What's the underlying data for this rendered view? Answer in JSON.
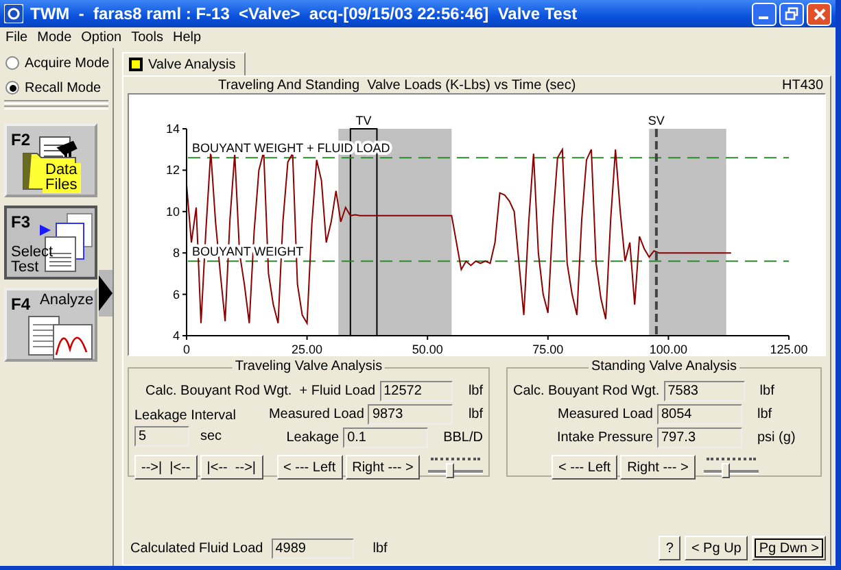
{
  "window": {
    "title": "TWM  -  faras8 raml : F-13  <Valve>  acq-[09/15/03 22:56:46]  Valve Test"
  },
  "menu": [
    "File",
    "Mode",
    "Option",
    "Tools",
    "Help"
  ],
  "modes": [
    {
      "label": "Acquire Mode",
      "selected": false
    },
    {
      "label": "Recall Mode",
      "selected": true
    }
  ],
  "function_keys": [
    {
      "key": "F2",
      "label": "Data Files",
      "kind": "folder",
      "selected": false
    },
    {
      "key": "F3",
      "label": "Select Test",
      "kind": "documents",
      "selected": true
    },
    {
      "key": "F4",
      "label": "Analyze",
      "kind": "charts",
      "selected": false
    }
  ],
  "tabs": [
    {
      "label": "Valve Analysis",
      "selected": true
    }
  ],
  "chart": {
    "code": "HT430",
    "chart_data": {
      "type": "line",
      "title": "Traveling And Standing  Valve Loads (K-Lbs) vs Time (sec)",
      "xlim": [
        0,
        125
      ],
      "ylim": [
        4,
        14
      ],
      "yticks": [
        4,
        6,
        8,
        10,
        12,
        14
      ],
      "xticks": [
        {
          "value": 0,
          "label": "0"
        },
        {
          "value": 25,
          "label": "25.00"
        },
        {
          "value": 50,
          "label": "50.00"
        },
        {
          "value": 75,
          "label": "75.00"
        },
        {
          "value": 100,
          "label": "100.00"
        },
        {
          "value": 125,
          "label": "125.00"
        }
      ],
      "x": [
        0,
        1,
        2,
        3,
        4,
        5,
        6,
        7,
        8,
        9,
        10,
        11,
        12,
        13,
        14,
        15,
        16,
        17,
        18,
        19,
        20,
        21,
        22,
        23,
        24,
        25,
        26,
        27,
        28,
        29,
        30,
        31,
        32,
        33,
        34,
        35,
        36,
        37,
        38,
        39,
        40,
        41,
        42,
        43,
        44,
        45,
        46,
        47,
        48,
        49,
        50,
        51,
        52,
        53,
        54,
        55,
        56,
        57,
        58,
        59,
        60,
        61,
        62,
        63,
        64,
        65,
        66,
        67,
        68,
        69,
        70,
        71,
        72,
        73,
        74,
        75,
        76,
        77,
        78,
        79,
        80,
        81,
        82,
        83,
        84,
        85,
        86,
        87,
        88,
        89,
        90,
        91,
        92,
        93,
        94,
        95,
        96,
        97,
        98,
        99,
        100,
        101,
        102,
        103,
        104,
        105,
        106,
        107,
        108,
        109,
        110,
        111,
        112,
        113
      ],
      "series": [
        {
          "color": "#8b0000",
          "values": [
            11.3,
            8.5,
            10.2,
            4.6,
            9,
            12.9,
            9.5,
            7,
            4.7,
            9.6,
            12.8,
            8,
            6.5,
            4.6,
            9,
            12,
            12.9,
            7,
            5.5,
            4.6,
            9.5,
            12.4,
            12.8,
            6.5,
            5,
            4.6,
            9.4,
            12.5,
            11.5,
            8.5,
            9.5,
            11,
            9.5,
            10.2,
            9.8,
            9.85,
            9.8,
            9.8,
            9.8,
            9.8,
            9.8,
            9.8,
            9.8,
            9.8,
            9.8,
            9.8,
            9.8,
            9.8,
            9.8,
            9.8,
            9.8,
            9.8,
            9.8,
            9.8,
            9.8,
            9.8,
            8.5,
            7.2,
            7.6,
            7.4,
            7.6,
            7.5,
            7.6,
            7.5,
            8.5,
            10.9,
            10.8,
            10.5,
            10,
            7.5,
            5,
            9.5,
            12.8,
            8,
            6,
            5.1,
            9.5,
            12.6,
            13,
            7.5,
            6,
            5,
            9.6,
            12.5,
            13,
            7.5,
            5.8,
            4.8,
            9.6,
            13,
            10,
            7.6,
            8.5,
            5.5,
            8.8,
            8.2,
            7.8,
            8.1,
            8,
            8,
            8,
            8,
            8,
            8,
            8,
            8,
            8,
            8,
            8,
            8,
            8,
            8,
            8,
            8
          ]
        }
      ],
      "ref_lines": [
        {
          "axis": "y",
          "value": 12.6,
          "label": "BOUYANT WEIGHT + FLUID LOAD"
        },
        {
          "axis": "y",
          "value": 7.6,
          "label": "BOUYANT WEIGHT"
        },
        {
          "axis": "x",
          "value": 97.5,
          "label": "SV"
        }
      ],
      "bands": [
        {
          "axis": "x",
          "from": 31.5,
          "to": 55
        },
        {
          "axis": "x",
          "from": 96,
          "to": 112
        },
        {
          "axis": "x",
          "from": 34,
          "to": 39.5,
          "label": "TV"
        }
      ]
    }
  },
  "traveling": {
    "title": "Traveling Valve Analysis",
    "fields": [
      {
        "label": "Calc. Bouyant Rod Wgt.  + Fluid Load",
        "value": "12572",
        "unit": "lbf"
      },
      {
        "label": "Measured Load",
        "value": "9873",
        "unit": "lbf"
      },
      {
        "label": "Leakage",
        "value": "0.1",
        "unit": "BBL/D"
      }
    ],
    "interval": {
      "label": "Leakage Interval",
      "value": "5",
      "unit": "sec"
    },
    "buttons": [
      "-->|  |<--",
      "|<--  -->|",
      "< --- Left",
      "Right --- >"
    ],
    "slider": {
      "level": 0.4
    }
  },
  "standing": {
    "title": "Standing Valve Analysis",
    "fields": [
      {
        "label": "Calc. Bouyant Rod Wgt.",
        "value": "7583",
        "unit": "lbf"
      },
      {
        "label": "Measured Load",
        "value": "8054",
        "unit": "lbf"
      },
      {
        "label": "Intake Pressure",
        "value": "797.3",
        "unit": "psi (g)"
      }
    ],
    "buttons": [
      "< --- Left",
      "Right --- >"
    ],
    "slider": {
      "level": 0.4
    }
  },
  "footer": {
    "fluid_load": {
      "label": "Calculated Fluid Load",
      "value": "4989",
      "unit": "lbf"
    },
    "buttons": [
      {
        "label": "?",
        "focused": false
      },
      {
        "label": "< Pg Up",
        "focused": false
      },
      {
        "label": "Pg Dwn >",
        "focused": true
      }
    ]
  }
}
